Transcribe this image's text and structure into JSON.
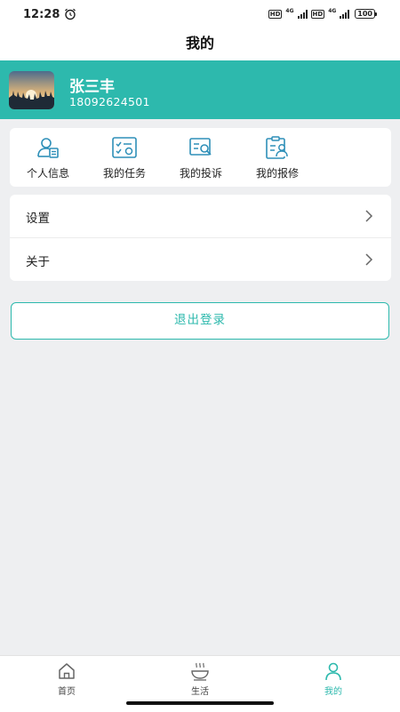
{
  "status_bar": {
    "time": "12:28",
    "hd1": "HD",
    "net1": "4G",
    "hd2": "HD",
    "net2": "4G",
    "battery": "100",
    "icons": [
      "alarm-icon",
      "signal-icon",
      "battery-icon"
    ]
  },
  "header": {
    "title": "我的"
  },
  "profile": {
    "name": "张三丰",
    "phone": "18092624501",
    "banner_color": "#2db9ad"
  },
  "shortcuts": [
    {
      "label": "个人信息",
      "icon": "personal-info-icon"
    },
    {
      "label": "我的任务",
      "icon": "task-icon"
    },
    {
      "label": "我的投诉",
      "icon": "complaint-icon"
    },
    {
      "label": "我的报修",
      "icon": "repair-icon"
    }
  ],
  "menu": [
    {
      "label": "设置",
      "icon": "chevron-right-icon"
    },
    {
      "label": "关于",
      "icon": "chevron-right-icon"
    }
  ],
  "logout": {
    "label": "退出登录"
  },
  "bottom_nav": [
    {
      "label": "首页",
      "icon": "home-icon",
      "active": false
    },
    {
      "label": "生活",
      "icon": "coffee-cup-icon",
      "active": false
    },
    {
      "label": "我的",
      "icon": "user-icon",
      "active": true
    }
  ],
  "colors": {
    "accent": "#2db9ad",
    "background": "#eeeff1"
  }
}
